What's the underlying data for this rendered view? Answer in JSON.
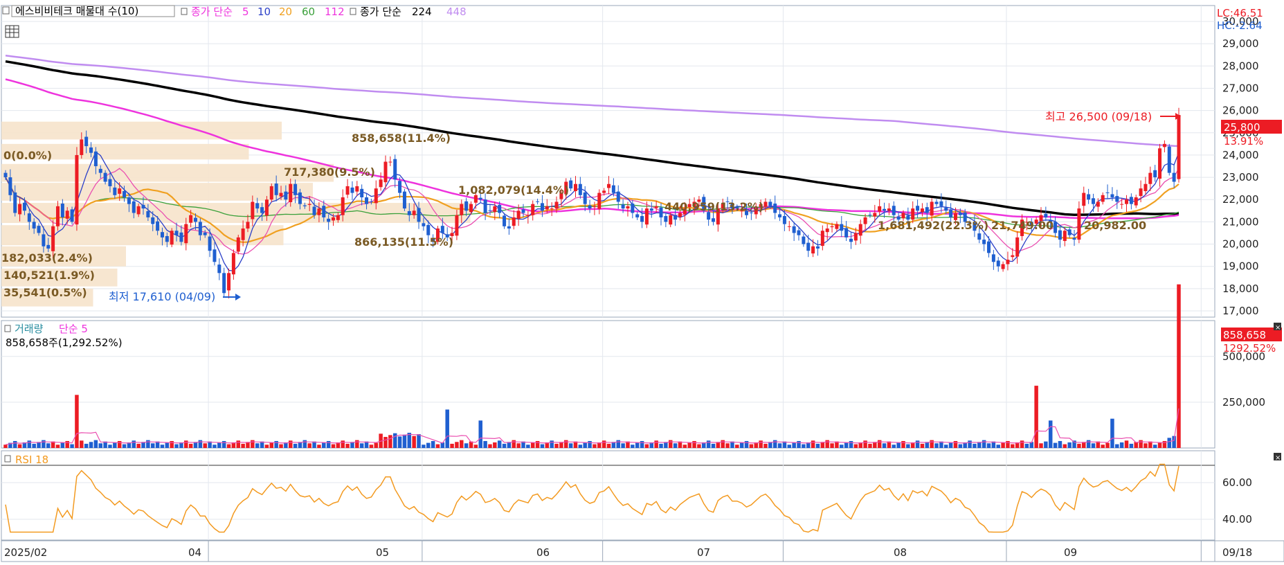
{
  "legend_main": {
    "stock_name": "에스비비테크 매물대 수(10)",
    "ma_label": "종가 단순",
    "ma_periods": [
      "5",
      "10",
      "20",
      "60",
      "112"
    ],
    "long_label": "종가 단순",
    "long_periods": [
      "224",
      "448"
    ]
  },
  "legend_volume": {
    "label": "거래량",
    "ma_label": "단순 5",
    "summary": "858,658주(1,292.52%)"
  },
  "legend_rsi": {
    "label": "RSI 18"
  },
  "right_info": {
    "lc": "LC:46.51",
    "hc": "HC:-2.64"
  },
  "last_price": {
    "value": "25,800",
    "change": "13.91%"
  },
  "last_volume": {
    "value": "858,658",
    "change": "1292.52%"
  },
  "annotations": {
    "high": "최고 26,500 (09/18)",
    "low": "최저 17,610 (04/09)"
  },
  "volume_profile": [
    {
      "label": "0(0.0%)"
    },
    {
      "label": "858,658(11.4%)"
    },
    {
      "label": "717,380(9.5%)"
    },
    {
      "label": "1,082,079(14.4%)"
    },
    {
      "label": "440,959(13.2%)"
    },
    {
      "label": "1,681,492(22.3%)"
    },
    {
      "label": "21,749.00"
    },
    {
      "label": "20,982.00"
    },
    {
      "label": "866,135(11.5%)"
    },
    {
      "label": "182,033(2.4%)"
    },
    {
      "label": "140,521(1.9%)"
    },
    {
      "label": "35,541(0.5%)"
    }
  ],
  "colors": {
    "up": "#ec1c24",
    "down": "#1f5fd0",
    "ma5": "#2a3fc8",
    "ma10": "#ea4fb0",
    "ma20": "#f0a020",
    "ma60": "#3aa03a",
    "ma112": "#ee33dd",
    "ma224": "#000000",
    "ma448": "#c08cf0",
    "rsi": "#f39a20",
    "profile": "#f6e3cb",
    "profile_text": "#7a5a24"
  },
  "chart_data": [
    {
      "type": "candlestick",
      "title": "에스비비테크",
      "y_ticks": [
        "30,000",
        "29,000",
        "28,000",
        "27,000",
        "26,000",
        "25,000",
        "24,000",
        "23,000",
        "22,000",
        "21,000",
        "20,000",
        "19,000",
        "18,000",
        "17,000"
      ],
      "ylim": [
        16700,
        30800
      ],
      "x_labels": [
        "2025/02",
        "04",
        "05",
        "06",
        "07",
        "08",
        "09",
        "09/18"
      ],
      "highest": 26500,
      "lowest": 17610,
      "last": 25800,
      "closes": [
        23000,
        22200,
        21400,
        21800,
        21500,
        21000,
        20700,
        20500,
        19900,
        19800,
        20800,
        21700,
        21200,
        21500,
        21000,
        24000,
        24700,
        24400,
        24100,
        23500,
        23200,
        22800,
        22600,
        22200,
        22500,
        22100,
        21800,
        21400,
        21700,
        21600,
        21200,
        20900,
        20600,
        20300,
        20100,
        20600,
        20400,
        20100,
        20900,
        21300,
        21000,
        20400,
        20400,
        19700,
        19200,
        18700,
        17800,
        18700,
        19600,
        20300,
        20700,
        21000,
        21900,
        21600,
        21400,
        22000,
        22600,
        22200,
        22300,
        22000,
        22700,
        22200,
        21800,
        21700,
        21800,
        21300,
        21600,
        21200,
        21000,
        21200,
        21300,
        22100,
        22600,
        22300,
        22600,
        22100,
        21800,
        21900,
        22500,
        22900,
        23700,
        23700,
        22900,
        22300,
        21600,
        21300,
        21500,
        21000,
        20800,
        20400,
        20100,
        20700,
        20500,
        20300,
        20500,
        21300,
        21800,
        21500,
        21800,
        22200,
        22000,
        21400,
        21500,
        21700,
        21400,
        20800,
        20700,
        21200,
        21500,
        21400,
        21300,
        21800,
        21900,
        21500,
        21700,
        21600,
        21900,
        22300,
        22800,
        22500,
        22700,
        22200,
        21800,
        21600,
        21700,
        22300,
        22400,
        22700,
        22300,
        21900,
        21600,
        21700,
        21400,
        21200,
        21000,
        21600,
        21500,
        21700,
        21200,
        21000,
        21300,
        21100,
        21400,
        21600,
        21800,
        21900,
        22000,
        21500,
        21100,
        21000,
        21600,
        21800,
        21900,
        21600,
        21600,
        21500,
        21300,
        21400,
        21600,
        21800,
        21900,
        21700,
        21400,
        21200,
        20900,
        20800,
        20500,
        20400,
        20000,
        19700,
        19900,
        19800,
        20600,
        20700,
        20800,
        20900,
        20600,
        20300,
        20100,
        20500,
        20900,
        21200,
        21300,
        21400,
        21700,
        21500,
        21600,
        21300,
        21100,
        21400,
        21100,
        21600,
        21500,
        21600,
        21400,
        21900,
        21800,
        21700,
        21500,
        21200,
        21400,
        21300,
        21000,
        20900,
        20600,
        20200,
        20000,
        19600,
        19200,
        19000,
        19100,
        19300,
        19500,
        20300,
        21100,
        21000,
        20800,
        21100,
        21300,
        21200,
        21000,
        20500,
        20200,
        20600,
        20400,
        20200,
        21600,
        22300,
        22000,
        21800,
        21900,
        22200,
        22300,
        22100,
        21900,
        21800,
        22000,
        21800,
        22100,
        22500,
        22700,
        23200,
        23000,
        24300,
        24500,
        23200,
        22800,
        25800
      ],
      "profile_bins": [
        {
          "low": 24700,
          "high": 25500,
          "volume_pct": 11.4
        },
        {
          "low": 23800,
          "high": 24500,
          "volume_pct": 9.5
        },
        {
          "low": 22800,
          "high": 23600,
          "volume_pct": 14.4
        },
        {
          "low": 21950,
          "high": 22750,
          "volume_pct": 13.2
        },
        {
          "low": 20950,
          "high": 21850,
          "volume_pct": 22.3
        },
        {
          "low": 19950,
          "high": 20850,
          "volume_pct": 11.5
        },
        {
          "low": 19000,
          "high": 19900,
          "volume_pct": 2.4
        },
        {
          "low": 18100,
          "high": 18900,
          "volume_pct": 1.9
        },
        {
          "low": 17200,
          "high": 18000,
          "volume_pct": 0.5
        },
        {
          "low": 25800,
          "high": 26500,
          "volume_pct": 0.0
        }
      ]
    },
    {
      "type": "bar",
      "title": "거래량",
      "y_ticks": [
        "500,000",
        "250,000"
      ],
      "ylim": [
        0,
        900000
      ],
      "last": 858658
    },
    {
      "type": "line",
      "title": "RSI 18",
      "y_ticks": [
        "60.00",
        "40.00"
      ],
      "ylim": [
        28,
        72
      ],
      "last": 69
    }
  ]
}
